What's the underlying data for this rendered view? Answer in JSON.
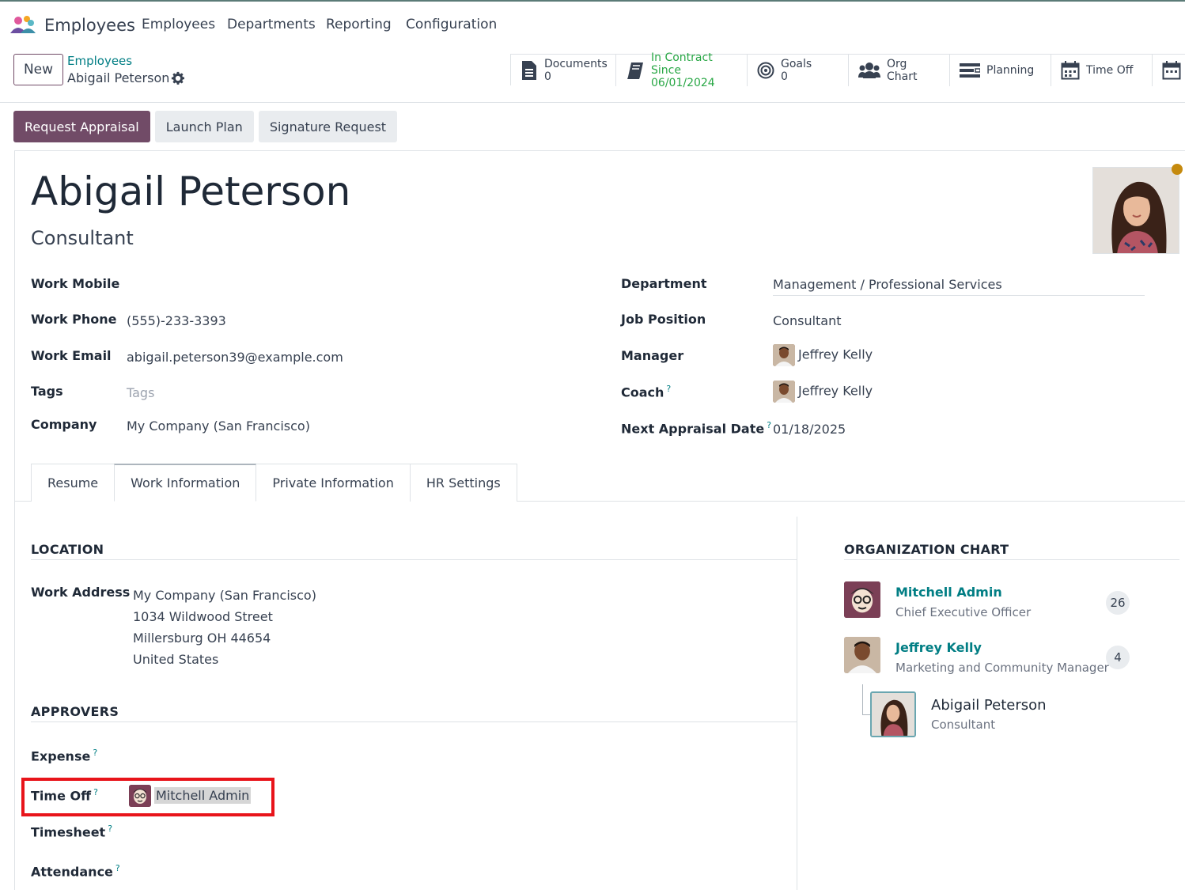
{
  "navbar": {
    "app_name": "Employees",
    "menu": [
      "Employees",
      "Departments",
      "Reporting",
      "Configuration"
    ]
  },
  "control_panel": {
    "new_label": "New",
    "breadcrumb_parent": "Employees",
    "breadcrumb_current": "Abigail Peterson",
    "smart_buttons": {
      "documents_label": "Documents",
      "documents_value": "0",
      "contract_label": "In Contract Since",
      "contract_value": "06/01/2024",
      "goals_label": "Goals",
      "goals_value": "0",
      "org_chart_label": "Org Chart",
      "planning_label": "Planning",
      "time_off_label": "Time Off"
    }
  },
  "statusbar": {
    "request_appraisal": "Request Appraisal",
    "launch_plan": "Launch Plan",
    "signature_request": "Signature Request"
  },
  "employee": {
    "name": "Abigail Peterson",
    "job_title": "Consultant"
  },
  "fields_left": {
    "work_mobile_label": "Work Mobile",
    "work_phone_label": "Work Phone",
    "work_phone_value": "(555)-233-3393",
    "work_email_label": "Work Email",
    "work_email_value": "abigail.peterson39@example.com",
    "tags_label": "Tags",
    "tags_placeholder": "Tags",
    "company_label": "Company",
    "company_value": "My Company (San Francisco)"
  },
  "fields_right": {
    "department_label": "Department",
    "department_value": "Management / Professional Services",
    "job_position_label": "Job Position",
    "job_position_value": "Consultant",
    "manager_label": "Manager",
    "manager_value": "Jeffrey Kelly",
    "coach_label": "Coach",
    "coach_value": "Jeffrey Kelly",
    "next_appraisal_label": "Next Appraisal Date",
    "next_appraisal_value": "01/18/2025",
    "help_mark": "?"
  },
  "tabs": [
    "Resume",
    "Work Information",
    "Private Information",
    "HR Settings"
  ],
  "location": {
    "title": "LOCATION",
    "work_address_label": "Work Address",
    "address_lines": [
      "My Company (San Francisco)",
      "1034 Wildwood Street",
      "Millersburg OH 44654",
      "United States"
    ]
  },
  "approvers": {
    "title": "APPROVERS",
    "expense_label": "Expense",
    "time_off_label": "Time Off",
    "time_off_value": "Mitchell Admin",
    "timesheet_label": "Timesheet",
    "attendance_label": "Attendance"
  },
  "org_chart": {
    "title": "ORGANIZATION CHART",
    "people": [
      {
        "name": "Mitchell Admin",
        "title": "Chief Executive Officer",
        "count": "26"
      },
      {
        "name": "Jeffrey Kelly",
        "title": "Marketing and Community Manager",
        "count": "4"
      }
    ],
    "self": {
      "name": "Abigail Peterson",
      "title": "Consultant"
    }
  },
  "colors": {
    "brand": "#714b67",
    "link": "#017e84",
    "highlight": "#e8141a",
    "contract_green": "#28a745"
  }
}
